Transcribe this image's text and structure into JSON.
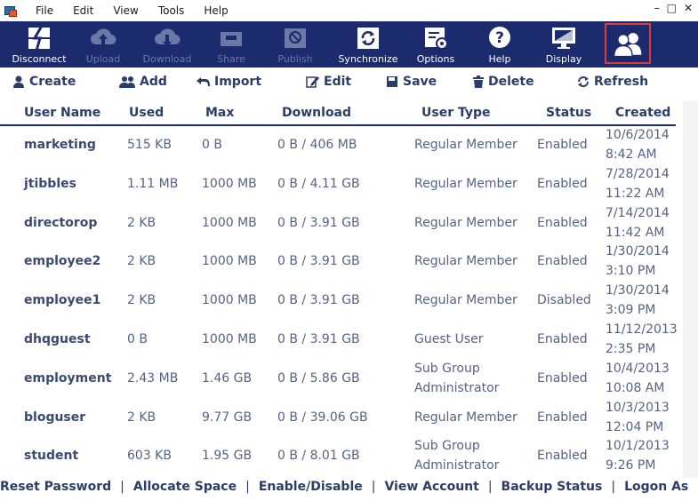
{
  "menu": {
    "items": [
      "File",
      "Edit",
      "View",
      "Tools",
      "Help"
    ],
    "window_controls": [
      "–",
      "□",
      "✕"
    ]
  },
  "toolbar": {
    "buttons": [
      {
        "label": "Disconnect",
        "icon": "disconnect-icon",
        "enabled": true
      },
      {
        "label": "Upload",
        "icon": "upload-cloud-icon",
        "enabled": false
      },
      {
        "label": "Download",
        "icon": "download-cloud-icon",
        "enabled": false
      },
      {
        "label": "Share",
        "icon": "share-icon",
        "enabled": false
      },
      {
        "label": "Publish",
        "icon": "publish-icon",
        "enabled": false
      },
      {
        "label": "Synchronize",
        "icon": "sync-icon",
        "enabled": true
      },
      {
        "label": "Options",
        "icon": "options-gear-icon",
        "enabled": true
      },
      {
        "label": "Help",
        "icon": "help-icon",
        "enabled": true
      },
      {
        "label": "Display",
        "icon": "display-monitor-icon",
        "enabled": true
      },
      {
        "label": "",
        "icon": "users-icon",
        "enabled": true,
        "active": true
      }
    ]
  },
  "actions": {
    "create": "Create",
    "add": "Add",
    "import": "Import",
    "edit": "Edit",
    "save": "Save",
    "delete": "Delete",
    "refresh": "Refresh"
  },
  "table": {
    "columns": [
      "User Name",
      "Used",
      "Max",
      "Download",
      "User Type",
      "Status",
      "Created"
    ],
    "rows": [
      {
        "user": "marketing",
        "used": "515 KB",
        "max": "0 B",
        "download": "0 B / 406 MB",
        "type1": "Regular Member",
        "type2": "",
        "status": "Enabled",
        "date": "10/6/2014",
        "time": "8:42 AM"
      },
      {
        "user": "jtibbles",
        "used": "1.11 MB",
        "max": "1000 MB",
        "download": "0 B / 4.11 GB",
        "type1": "Regular Member",
        "type2": "",
        "status": "Enabled",
        "date": "7/28/2014",
        "time": "11:22 AM"
      },
      {
        "user": "directorop",
        "used": "2 KB",
        "max": "1000 MB",
        "download": "0 B / 3.91 GB",
        "type1": "Regular Member",
        "type2": "",
        "status": "Enabled",
        "date": "7/14/2014",
        "time": "11:42 AM"
      },
      {
        "user": "employee2",
        "used": "2 KB",
        "max": "1000 MB",
        "download": "0 B / 3.91 GB",
        "type1": "Regular Member",
        "type2": "",
        "status": "Enabled",
        "date": "1/30/2014",
        "time": "3:10 PM"
      },
      {
        "user": "employee1",
        "used": "2 KB",
        "max": "1000 MB",
        "download": "0 B / 3.91 GB",
        "type1": "Regular Member",
        "type2": "",
        "status": "Disabled",
        "date": "1/30/2014",
        "time": "3:09 PM"
      },
      {
        "user": "dhqguest",
        "used": "0 B",
        "max": "1000 MB",
        "download": "0 B / 3.91 GB",
        "type1": "Guest User",
        "type2": "",
        "status": "Enabled",
        "date": "11/12/2013",
        "time": "2:35 PM"
      },
      {
        "user": "employment",
        "used": "2.43 MB",
        "max": "1.46 GB",
        "download": "0 B / 5.86 GB",
        "type1": "Sub Group",
        "type2": "Administrator",
        "status": "Enabled",
        "date": "10/4/2013",
        "time": "10:08 AM"
      },
      {
        "user": "bloguser",
        "used": "2 KB",
        "max": "9.77 GB",
        "download": "0 B / 39.06 GB",
        "type1": "Regular Member",
        "type2": "",
        "status": "Enabled",
        "date": "10/3/2013",
        "time": "12:04 PM"
      },
      {
        "user": "student",
        "used": "603 KB",
        "max": "1.95 GB",
        "download": "0 B / 8.01 GB",
        "type1": "Sub Group",
        "type2": "Administrator",
        "status": "Enabled",
        "date": "10/1/2013",
        "time": "9:26 PM"
      }
    ]
  },
  "footer": {
    "links": [
      "Reset Password",
      "Allocate Space",
      "Enable/Disable",
      "View Account",
      "Backup Status",
      "Logon As"
    ],
    "separator": "|"
  },
  "colors": {
    "toolbar_bg": "#1c2a6e",
    "active_border": "#e03b3b",
    "text_dark": "#2b3d6b",
    "text_cell": "#556383"
  }
}
